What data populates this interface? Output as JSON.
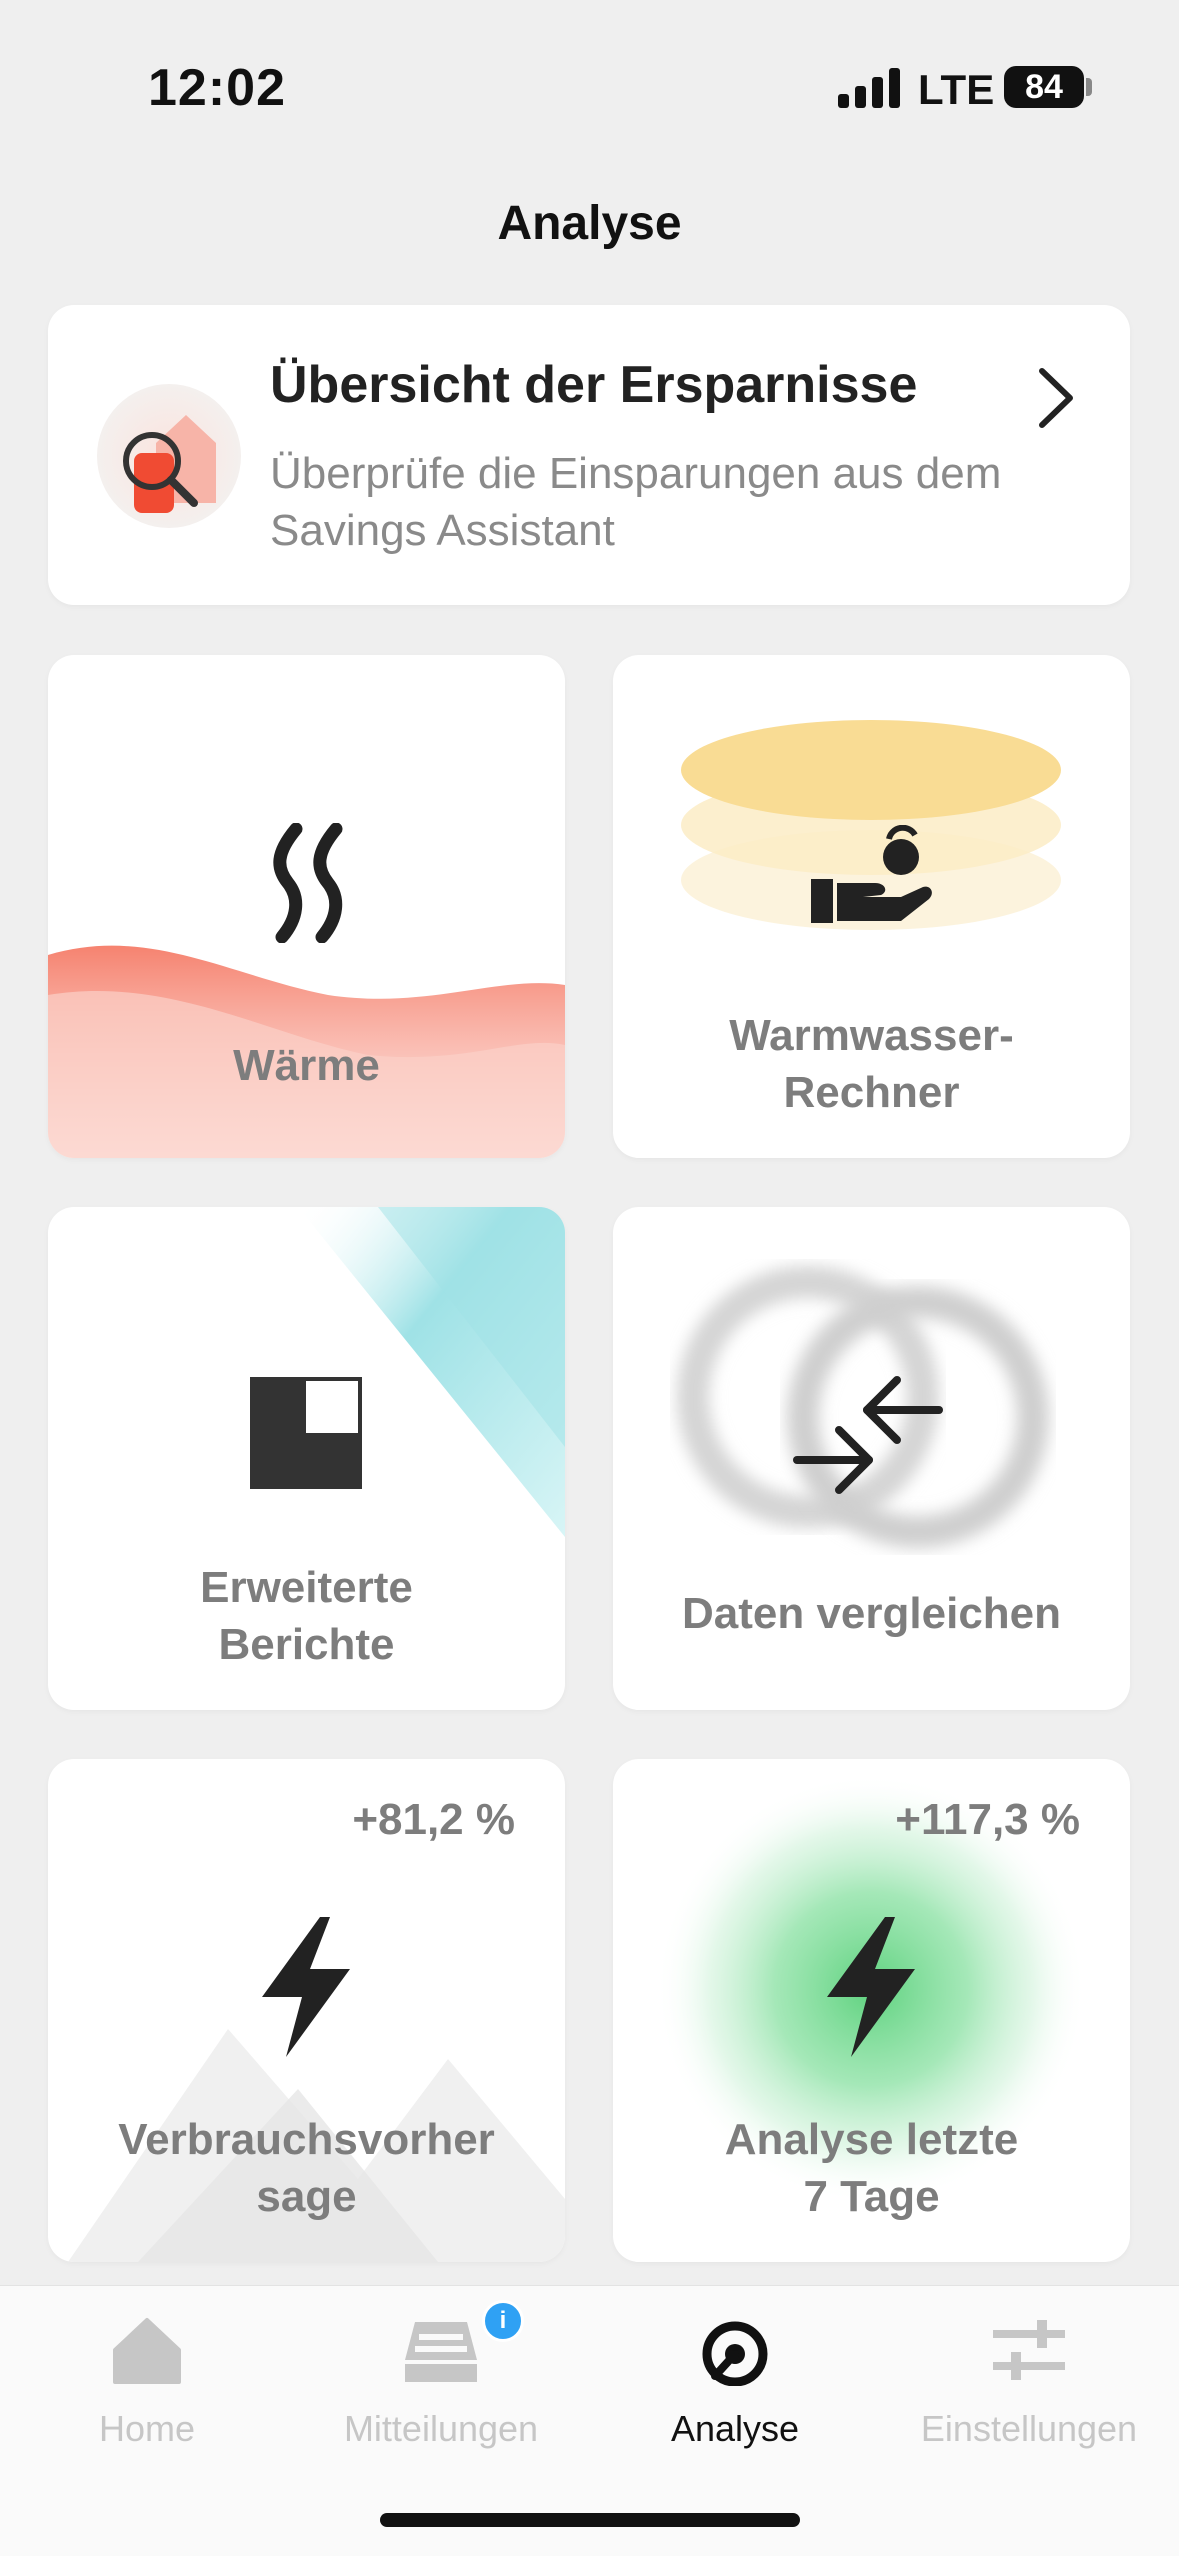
{
  "status": {
    "time": "12:02",
    "network": "LTE",
    "battery": "84"
  },
  "page": {
    "title": "Analyse"
  },
  "savings": {
    "title": "Übersicht der Ersparnisse",
    "subtitle": "Überprüfe die Einsparungen aus dem Savings Assistant",
    "icon": "magnifier-house-icon"
  },
  "tiles": [
    {
      "label": "Wärme",
      "icon": "heat-waves-icon",
      "accent": "#f5806e"
    },
    {
      "label": "Warmwasser-\nRechner",
      "icon": "hand-coin-icon",
      "accent": "#f7d77a"
    },
    {
      "label": "Erweiterte\nBerichte",
      "icon": "report-icon",
      "accent": "#7fd9de"
    },
    {
      "label": "Daten vergleichen",
      "icon": "compare-arrows-icon",
      "accent": "#bdbdbd"
    },
    {
      "label": "Verbrauchsvorher\nsage",
      "icon": "lightning-icon",
      "percent": "+81,2 %",
      "accent": "#dddddd"
    },
    {
      "label": "Analyse letzte\n7 Tage",
      "icon": "lightning-icon",
      "percent": "+117,3 %",
      "accent": "#6fdc8e"
    }
  ],
  "tabbar": {
    "items": [
      {
        "label": "Home",
        "icon": "house-icon",
        "active": false
      },
      {
        "label": "Mitteilungen",
        "icon": "inbox-icon",
        "active": false,
        "badge": "i"
      },
      {
        "label": "Analyse",
        "icon": "analysis-icon",
        "active": true
      },
      {
        "label": "Einstellungen",
        "icon": "sliders-icon",
        "active": false
      }
    ]
  }
}
